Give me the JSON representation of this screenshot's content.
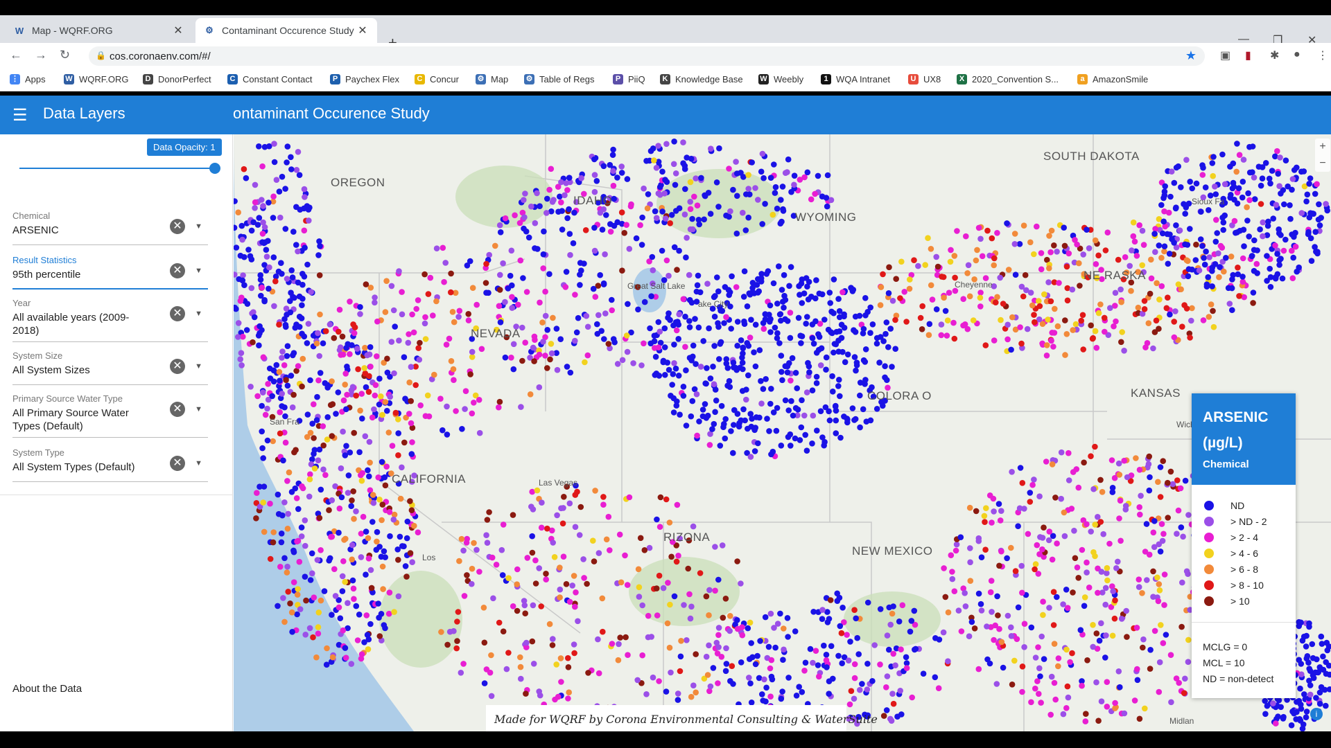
{
  "browser": {
    "tabs": [
      {
        "title": "Map - WQRF.ORG",
        "favicon": "W"
      },
      {
        "title": "Contaminant Occurence Study",
        "favicon": "⚙"
      }
    ],
    "url": "cos.coronaenv.com/#/",
    "bookmarks": [
      {
        "label": "Apps",
        "icon": "apps-grid",
        "color": "#4285f4"
      },
      {
        "label": "WQRF.ORG",
        "icon": "W",
        "color": "#2f5ea3"
      },
      {
        "label": "DonorPerfect",
        "icon": "D",
        "color": "#444"
      },
      {
        "label": "Constant Contact",
        "icon": "C",
        "color": "#1c5fb0"
      },
      {
        "label": "Paychex Flex",
        "icon": "P",
        "color": "#1d5fad"
      },
      {
        "label": "Concur",
        "icon": "C",
        "color": "#e8b800"
      },
      {
        "label": "Map",
        "icon": "⚙",
        "color": "#3c6fb5"
      },
      {
        "label": "Table of Regs",
        "icon": "⚙",
        "color": "#3c6fb5"
      },
      {
        "label": "PiiQ",
        "icon": "P",
        "color": "#5b4fa8"
      },
      {
        "label": "Knowledge Base",
        "icon": "K",
        "color": "#444"
      },
      {
        "label": "Weebly",
        "icon": "W",
        "color": "#222"
      },
      {
        "label": "WQA Intranet",
        "icon": "1",
        "color": "#111"
      },
      {
        "label": "UX8",
        "icon": "U",
        "color": "#e74c3c"
      },
      {
        "label": "2020_Convention S...",
        "icon": "X",
        "color": "#1e7145"
      },
      {
        "label": "AmazonSmile",
        "icon": "a",
        "color": "#f0a020"
      }
    ]
  },
  "header": {
    "sidebar_title": "Data Layers",
    "app_title": "ontaminant Occurence Study"
  },
  "sidebar": {
    "opacity_label": "Data Opacity: 1",
    "opacity_value": 1,
    "fields": [
      {
        "label": "Chemical",
        "value": "ARSENIC"
      },
      {
        "label": "Result Statistics",
        "value": "95th percentile"
      },
      {
        "label": "Year",
        "value": "All available years (2009-2018)"
      },
      {
        "label": "System Size",
        "value": "All System Sizes"
      },
      {
        "label": "Primary Source Water Type",
        "value": "All Primary Source Water Types (Default)"
      },
      {
        "label": "System Type",
        "value": "All System Types (Default)"
      }
    ],
    "about_link": "About the Data"
  },
  "map": {
    "state_labels": [
      "OREGON",
      "IDAHO",
      "WYOMING",
      "SOUTH DAKOTA",
      "NE RASKA",
      "NEVADA",
      "COLORA O",
      "KANSAS",
      "CALIFORNIA",
      "RIZONA",
      "NEW MEXICO"
    ],
    "city_labels": [
      "Great Salt Lake",
      "Cheyenne",
      "Sioux Fa",
      "San Fra",
      "Los",
      "Las Vegas",
      "Wich",
      "Midlan",
      "ake City"
    ],
    "credit": "Made for WQRF by Corona Environmental Consulting & WaterSuite"
  },
  "legend": {
    "chemical": "ARSENIC",
    "unit": "(µg/L)",
    "subtitle": "Chemical",
    "items": [
      {
        "label": "ND",
        "color": "#1a12e6"
      },
      {
        "label": "> ND - 2",
        "color": "#9b4fe8"
      },
      {
        "label": "> 2 - 4",
        "color": "#e81ed2"
      },
      {
        "label": "> 4 - 6",
        "color": "#f2d21e"
      },
      {
        "label": "> 6 - 8",
        "color": "#f28a3a"
      },
      {
        "label": "> 8 - 10",
        "color": "#e01818"
      },
      {
        "label": "> 10",
        "color": "#8b1a10"
      }
    ],
    "notes": [
      "MCLG = 0",
      "MCL = 10",
      "ND = non-detect"
    ]
  }
}
